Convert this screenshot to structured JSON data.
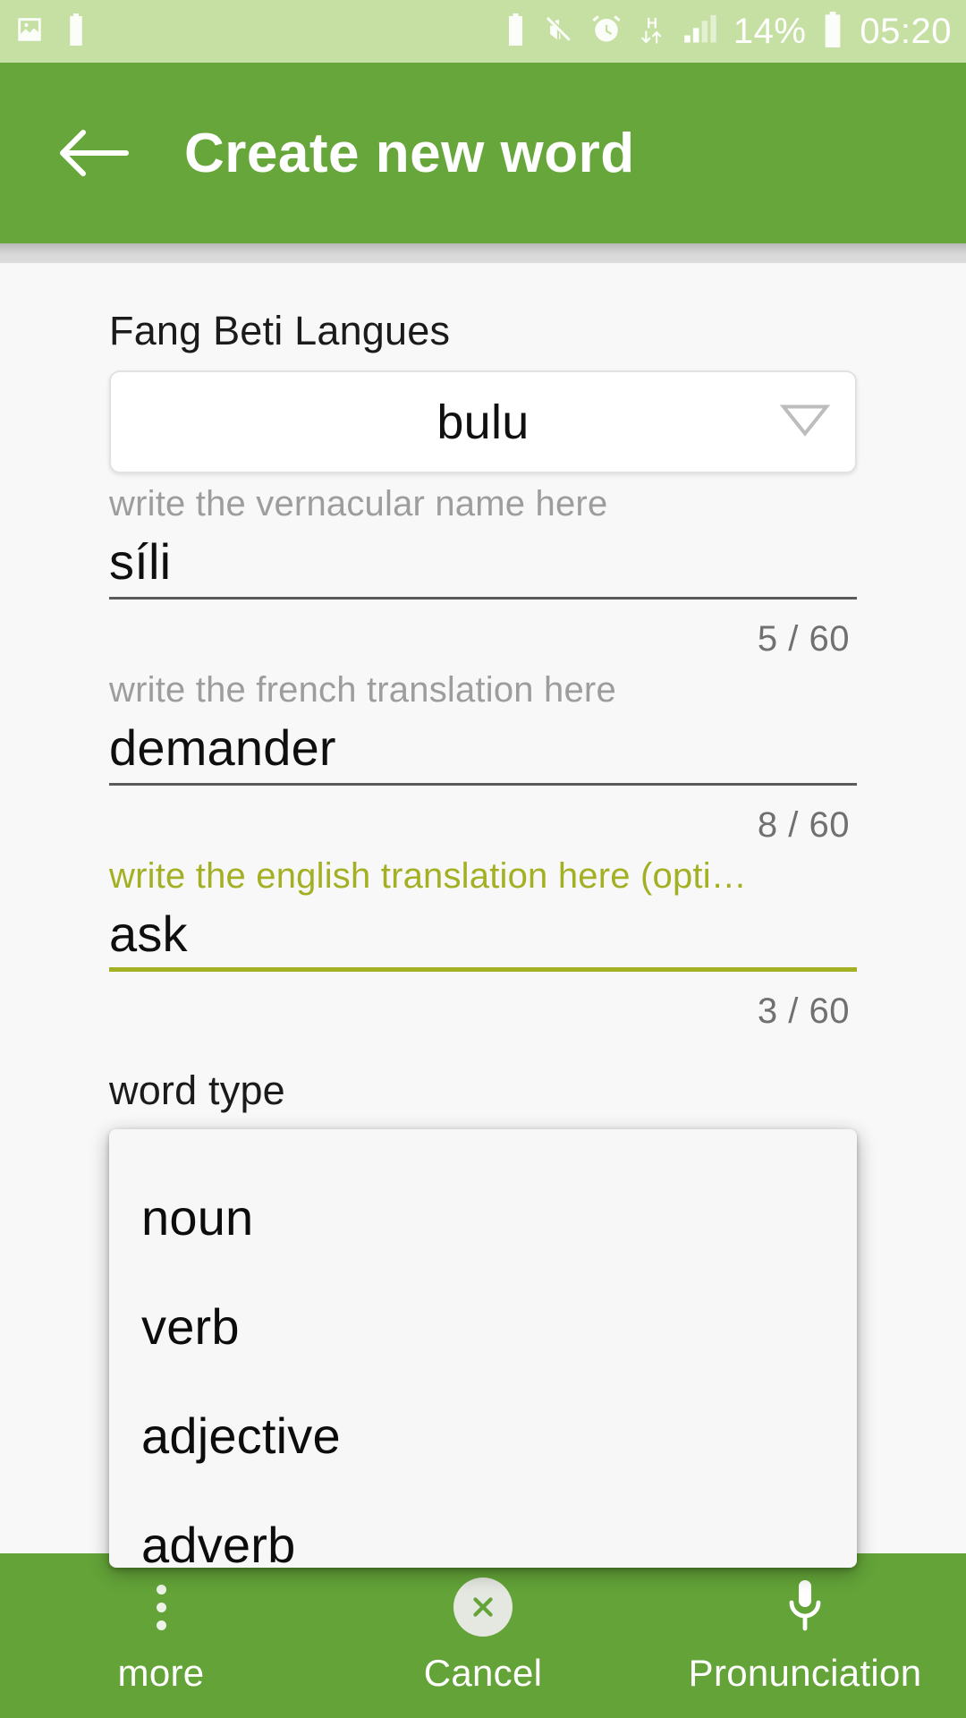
{
  "status_bar": {
    "left_icons": [
      "image-icon",
      "battery-alert-icon"
    ],
    "right_icons": [
      "battery-saver-icon",
      "mute-icon",
      "alarm-icon",
      "hsdpa-data-icon",
      "signal-bars-icon",
      "battery-icon"
    ],
    "battery_percent": "14%",
    "time": "05:20",
    "background_color": "#c6e0a4"
  },
  "header": {
    "back_icon": "arrow-left-icon",
    "title": "Create new word",
    "background_color": "#66a63a"
  },
  "form": {
    "language": {
      "label": "Fang Beti Langues",
      "selected": "bulu",
      "arrow_icon": "chevron-down-icon"
    },
    "vernacular": {
      "hint": "write the vernacular name here",
      "value": "síli",
      "counter": "5 / 60",
      "active": false
    },
    "french": {
      "hint": "write the french translation here",
      "value": "demander",
      "counter": "8 / 60",
      "active": false
    },
    "english": {
      "hint": "write the english translation here (opti…",
      "value": "ask",
      "counter": "3 / 60",
      "active": true,
      "accent_color": "#a3b023"
    },
    "word_type": {
      "label": "word type",
      "options": [
        "noun",
        "verb",
        "adjective",
        "adverb"
      ]
    }
  },
  "bottom_bar": {
    "background_color": "#63a338",
    "actions": [
      {
        "label": "more",
        "icon": "overflow-dots-icon"
      },
      {
        "label": "Cancel",
        "icon": "close-circle-icon"
      },
      {
        "label": "Pronunciation",
        "icon": "microphone-icon"
      }
    ]
  }
}
